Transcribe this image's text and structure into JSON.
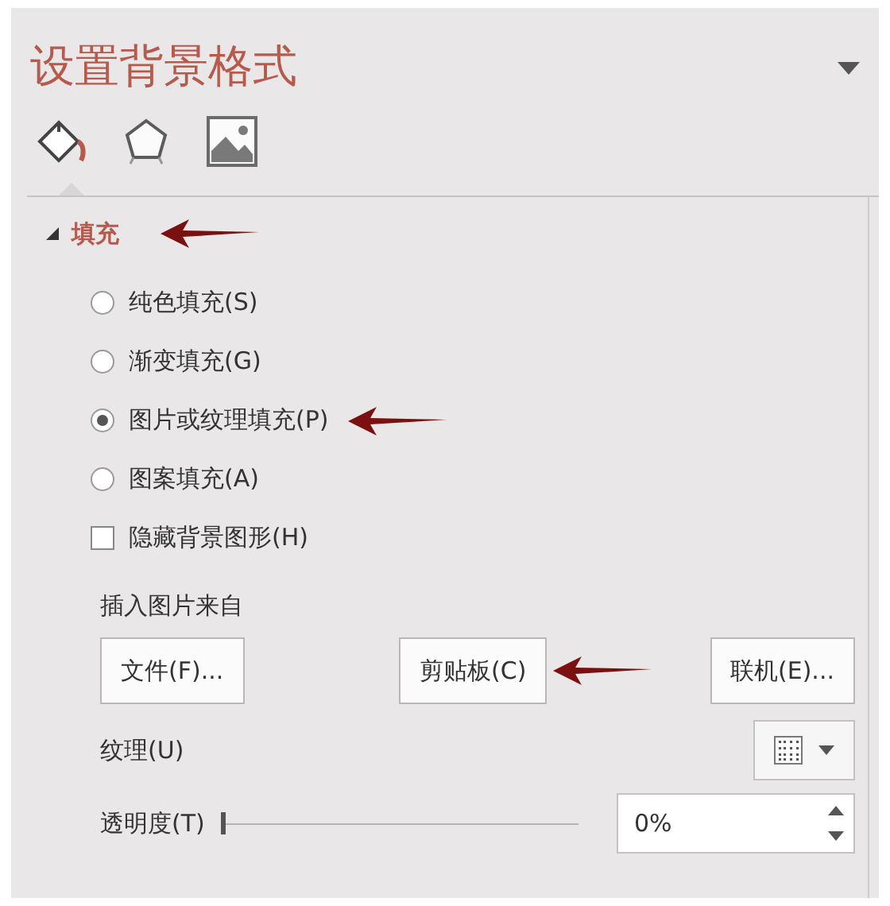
{
  "pane": {
    "title": "设置背景格式"
  },
  "tabs": [
    {
      "kind": "fill",
      "selected": true
    },
    {
      "kind": "effects",
      "selected": false
    },
    {
      "kind": "picture",
      "selected": false
    }
  ],
  "section": {
    "label": "填充",
    "expanded": true,
    "annotated": true
  },
  "fill_options": [
    {
      "label": "纯色填充(S)",
      "selected": false,
      "annotated": false
    },
    {
      "label": "渐变填充(G)",
      "selected": false,
      "annotated": false
    },
    {
      "label": "图片或纹理填充(P)",
      "selected": true,
      "annotated": true
    },
    {
      "label": "图案填充(A)",
      "selected": false,
      "annotated": false
    }
  ],
  "hide_graphics": {
    "label": "隐藏背景图形(H)",
    "checked": false
  },
  "insert_from": {
    "label": "插入图片来自",
    "buttons": [
      {
        "label": "文件(F)...",
        "annotated": false
      },
      {
        "label": "剪贴板(C)",
        "annotated": true
      },
      {
        "label": "联机(E)...",
        "annotated": false
      }
    ]
  },
  "texture": {
    "label": "纹理(U)"
  },
  "transparency": {
    "label": "透明度(T)",
    "level": 0,
    "value": "0%"
  }
}
